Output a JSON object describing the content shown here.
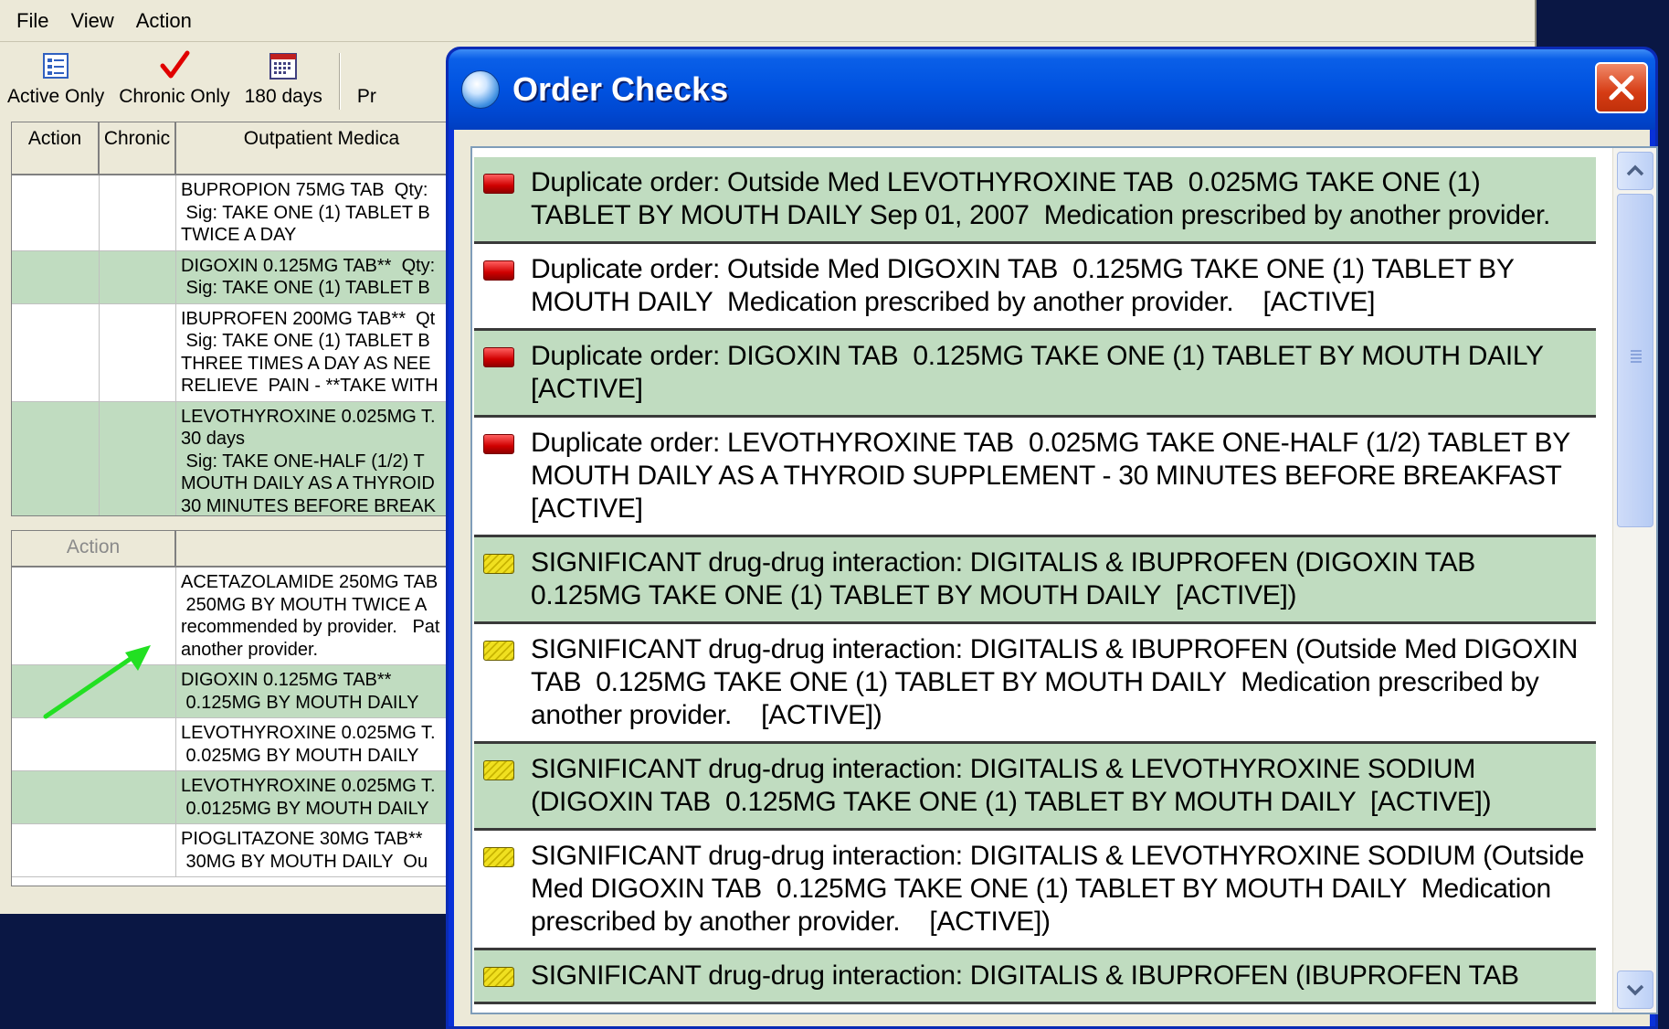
{
  "app": {
    "menu": [
      "File",
      "View",
      "Action"
    ],
    "toolbar": [
      {
        "label": "Active Only",
        "icon": "list-icon"
      },
      {
        "label": "Chronic Only",
        "icon": "checkmark-icon"
      },
      {
        "label": "180 days",
        "icon": "calendar-icon"
      },
      {
        "label": "Pr",
        "icon": "partial-icon"
      }
    ],
    "grid1": {
      "headers": [
        "Action",
        "Chronic",
        "Outpatient Medica"
      ],
      "rows": [
        {
          "text": "BUPROPION 75MG TAB  Qty:\n Sig: TAKE ONE (1) TABLET B\nTWICE A DAY",
          "green": false
        },
        {
          "text": "DIGOXIN 0.125MG TAB**  Qty:\n Sig: TAKE ONE (1) TABLET B",
          "green": true
        },
        {
          "text": "IBUPROFEN 200MG TAB**  Qt\n Sig: TAKE ONE (1) TABLET B\nTHREE TIMES A DAY AS NEE\nRELIEVE  PAIN - **TAKE WITH",
          "green": false
        },
        {
          "text": "LEVOTHYROXINE 0.025MG T.\n30 days\n Sig: TAKE ONE-HALF (1/2) T\nMOUTH DAILY AS A THYROID\n30 MINUTES BEFORE BREAK",
          "green": true
        }
      ]
    },
    "grid2": {
      "headers": [
        "Action"
      ],
      "rows": [
        {
          "text": "ACETAZOLAMIDE 250MG TAB\n 250MG BY MOUTH TWICE A\nrecommended by provider.   Pat\nanother provider.",
          "green": false
        },
        {
          "text": "DIGOXIN 0.125MG TAB**\n 0.125MG BY MOUTH DAILY",
          "green": true
        },
        {
          "text": "LEVOTHYROXINE 0.025MG T.\n 0.025MG BY MOUTH DAILY",
          "green": false
        },
        {
          "text": "LEVOTHYROXINE 0.025MG T.\n 0.0125MG BY MOUTH DAILY",
          "green": true
        },
        {
          "text": "PIOGLITAZONE 30MG TAB**\n 30MG BY MOUTH DAILY  Ou",
          "green": false
        }
      ]
    }
  },
  "dialog": {
    "title": "Order Checks",
    "close_icon": "close-icon",
    "severity_colors": {
      "high": "#d00000",
      "moderate": "#e8d800"
    },
    "items": [
      {
        "severity": "high",
        "green": true,
        "text": "Duplicate order: Outside Med LEVOTHYROXINE TAB  0.025MG TAKE ONE (1)\nTABLET BY MOUTH DAILY Sep 01, 2007  Medication prescribed by another provider."
      },
      {
        "severity": "high",
        "green": false,
        "text": "Duplicate order: Outside Med DIGOXIN TAB  0.125MG TAKE ONE (1) TABLET BY\nMOUTH DAILY  Medication prescribed by another provider.    [ACTIVE]"
      },
      {
        "severity": "high",
        "green": true,
        "text": "Duplicate order: DIGOXIN TAB  0.125MG TAKE ONE (1) TABLET BY MOUTH DAILY\n[ACTIVE]"
      },
      {
        "severity": "high",
        "green": false,
        "text": "Duplicate order: LEVOTHYROXINE TAB  0.025MG TAKE ONE-HALF (1/2) TABLET BY\nMOUTH DAILY AS A THYROID SUPPLEMENT - 30 MINUTES BEFORE BREAKFAST\n[ACTIVE]"
      },
      {
        "severity": "moderate",
        "green": true,
        "text": "SIGNIFICANT drug-drug interaction: DIGITALIS & IBUPROFEN (DIGOXIN TAB\n0.125MG TAKE ONE (1) TABLET BY MOUTH DAILY  [ACTIVE])"
      },
      {
        "severity": "moderate",
        "green": false,
        "text": "SIGNIFICANT drug-drug interaction: DIGITALIS & IBUPROFEN (Outside Med DIGOXIN\nTAB  0.125MG TAKE ONE (1) TABLET BY MOUTH DAILY  Medication prescribed by\nanother provider.    [ACTIVE])"
      },
      {
        "severity": "moderate",
        "green": true,
        "text": "SIGNIFICANT drug-drug interaction: DIGITALIS & LEVOTHYROXINE SODIUM\n(DIGOXIN TAB  0.125MG TAKE ONE (1) TABLET BY MOUTH DAILY  [ACTIVE])"
      },
      {
        "severity": "moderate",
        "green": false,
        "text": "SIGNIFICANT drug-drug interaction: DIGITALIS & LEVOTHYROXINE SODIUM (Outside\nMed DIGOXIN TAB  0.125MG TAKE ONE (1) TABLET BY MOUTH DAILY  Medication\nprescribed by another provider.    [ACTIVE])"
      },
      {
        "severity": "moderate",
        "green": true,
        "text": "SIGNIFICANT drug-drug interaction: DIGITALIS & IBUPROFEN (IBUPROFEN TAB"
      }
    ]
  }
}
